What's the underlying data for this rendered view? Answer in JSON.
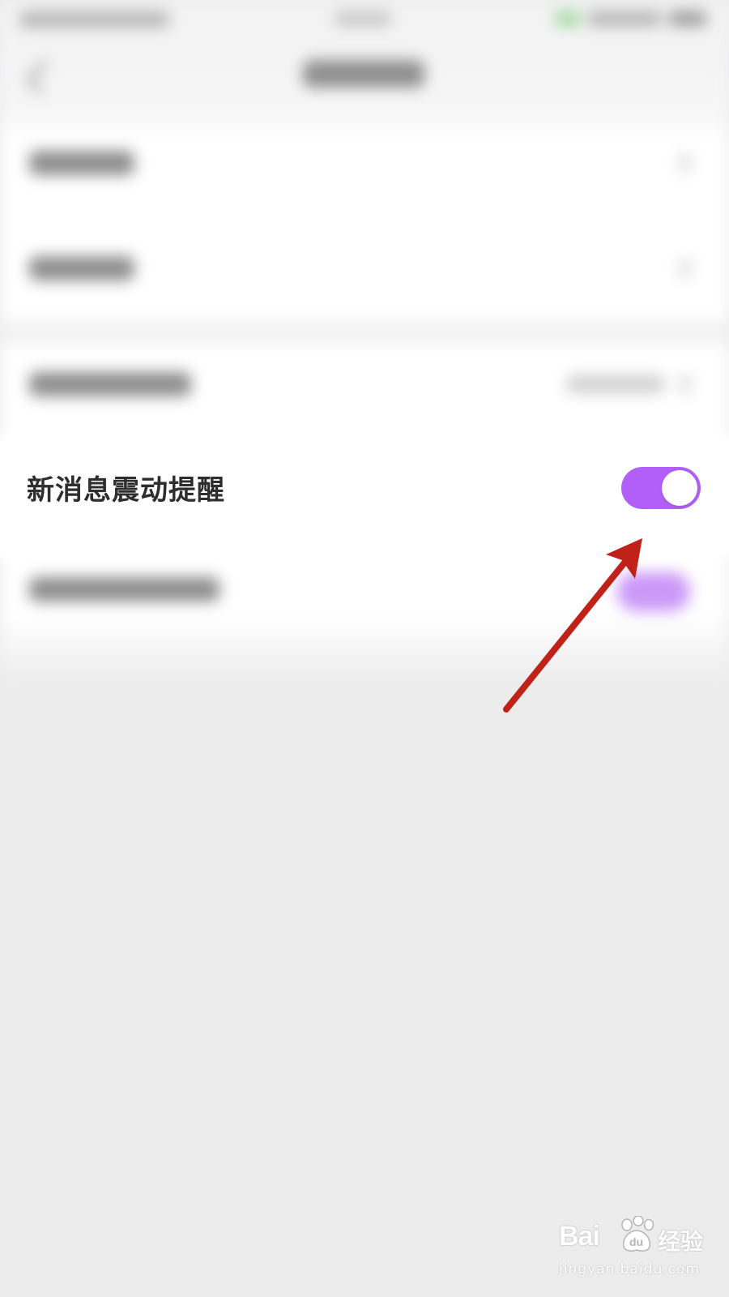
{
  "vibration_setting": {
    "label": "新消息震动提醒",
    "enabled": true,
    "toggle_color": "#B15FF8"
  },
  "annotation": {
    "color": "#C0221A",
    "icon": "arrow-icon"
  },
  "watermark": {
    "logo": "Bai",
    "logo_suffix": "经验",
    "domain": "jingyan.baidu.com",
    "icon": "paw-icon"
  }
}
